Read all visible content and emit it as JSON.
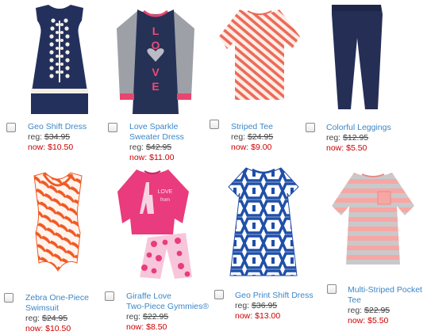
{
  "labels": {
    "reg": "reg:",
    "now": "now:"
  },
  "products": [
    {
      "name_lines": [
        "Geo Shift Dress"
      ],
      "reg_price": "$34.95",
      "now_price": "$10.50",
      "image": "navy-shift-dress-with-white-dots"
    },
    {
      "name_lines": [
        "Love Sparkle",
        "Sweater Dress"
      ],
      "reg_price": "$42.95",
      "now_price": "$11.00",
      "image": "navy-sweater-dress-love"
    },
    {
      "name_lines": [
        "Striped Tee"
      ],
      "reg_price": "$24.95",
      "now_price": "$9.00",
      "image": "coral-striped-tee"
    },
    {
      "name_lines": [
        "Colorful Leggings"
      ],
      "reg_price": "$12.95",
      "now_price": "$5.50",
      "image": "navy-leggings"
    },
    {
      "name_lines": [
        "Zebra One-Piece",
        "Swimsuit"
      ],
      "reg_price": "$24.95",
      "now_price": "$10.50",
      "image": "orange-zebra-swimsuit"
    },
    {
      "name_lines": [
        "Giraffe Love",
        "Two-Piece Gymmies®"
      ],
      "reg_price": "$22.95",
      "now_price": "$8.50",
      "image": "pink-giraffe-pajamas"
    },
    {
      "name_lines": [
        "Geo Print Shift Dress"
      ],
      "reg_price": "$36.95",
      "now_price": "$13.00",
      "image": "blue-geo-print-dress"
    },
    {
      "name_lines": [
        "Multi-Striped Pocket",
        "Tee"
      ],
      "reg_price": "$22.95",
      "now_price": "$5.50",
      "image": "pink-grey-striped-pocket-tee"
    }
  ],
  "colors": {
    "link": "#3a87c8",
    "sale": "#cc0000",
    "text": "#444444"
  }
}
